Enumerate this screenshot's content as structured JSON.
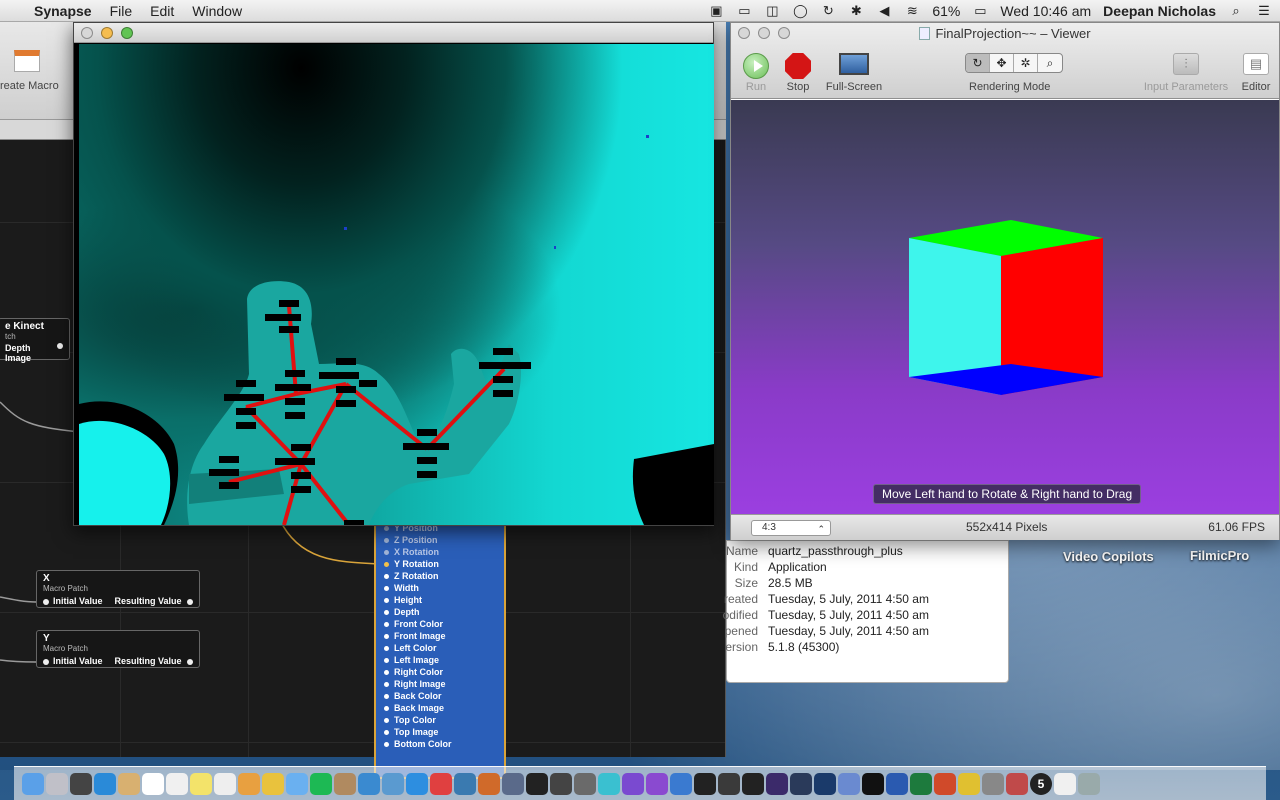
{
  "menubar": {
    "app_name": "Synapse",
    "menus": [
      "File",
      "Edit",
      "Window"
    ],
    "battery": "61%",
    "clock": "Wed 10:46 am",
    "user": "Deepan Nicholas"
  },
  "editor": {
    "toolbar_label": "reate Macro",
    "patches": {
      "kinect": {
        "title": "e Kinect",
        "subtitle": "tch",
        "output": "Depth Image"
      },
      "x": {
        "title": "X",
        "subtitle": "Macro Patch",
        "input": "Initial Value",
        "output": "Resulting Value"
      },
      "y": {
        "title": "Y",
        "subtitle": "Macro Patch",
        "input": "Initial Value",
        "output": "Resulting Value"
      }
    },
    "cube_ports": [
      {
        "label": "Y Position",
        "state": "dim"
      },
      {
        "label": "Z Position",
        "state": "dim"
      },
      {
        "label": "X Rotation",
        "state": "dim"
      },
      {
        "label": "Y Rotation",
        "state": "connected"
      },
      {
        "label": "Z Rotation",
        "state": "normal"
      },
      {
        "label": "Width",
        "state": "normal"
      },
      {
        "label": "Height",
        "state": "normal"
      },
      {
        "label": "Depth",
        "state": "normal"
      },
      {
        "label": "Front Color",
        "state": "normal"
      },
      {
        "label": "Front Image",
        "state": "normal"
      },
      {
        "label": "Left Color",
        "state": "normal"
      },
      {
        "label": "Left Image",
        "state": "normal"
      },
      {
        "label": "Right Color",
        "state": "normal"
      },
      {
        "label": "Right Image",
        "state": "normal"
      },
      {
        "label": "Back Color",
        "state": "normal"
      },
      {
        "label": "Back Image",
        "state": "normal"
      },
      {
        "label": "Top Color",
        "state": "normal"
      },
      {
        "label": "Top Image",
        "state": "normal"
      },
      {
        "label": "Bottom Color",
        "state": "normal"
      }
    ]
  },
  "viewer": {
    "title": "FinalProjection~~ – Viewer",
    "buttons": {
      "run": "Run",
      "stop": "Stop",
      "fullscreen": "Full-Screen",
      "rendering_mode": "Rendering Mode",
      "input_parameters": "Input Parameters",
      "editor": "Editor"
    },
    "hint": "Move Left hand to Rotate & Right hand to Drag",
    "aspect": "4:3",
    "dimensions": "552x414 Pixels",
    "fps": "61.06 FPS",
    "colors": {
      "cube_front": "#3ef5ec",
      "cube_right": "#ff0000",
      "cube_top": "#00ff00",
      "cube_bottom": "#0000ff"
    }
  },
  "info": {
    "rows": [
      {
        "key": "Name",
        "value": "quartz_passthrough_plus"
      },
      {
        "key": "Kind",
        "value": "Application"
      },
      {
        "key": "Size",
        "value": "28.5 MB"
      },
      {
        "key": "reated",
        "value": "Tuesday, 5 July, 2011 4:50 am"
      },
      {
        "key": "odified",
        "value": "Tuesday, 5 July, 2011 4:50 am"
      },
      {
        "key": "pened",
        "value": "Tuesday, 5 July, 2011 4:50 am"
      },
      {
        "key": "ersion",
        "value": "5.1.8 (45300)"
      }
    ]
  },
  "desktop": {
    "labels": [
      "Video Copilots",
      "FilmicPro"
    ]
  },
  "dock": {
    "icons": [
      "finder-icon",
      "launchpad-icon",
      "photo-booth-icon",
      "safari-icon",
      "preview-icon",
      "calendar-icon",
      "notes-icon",
      "stickies-icon",
      "textedit-icon",
      "pages-icon",
      "pencil-icon",
      "itunes-icon",
      "spotify-icon",
      "contacts-icon",
      "iphoto-icon",
      "mail-icon",
      "appstore-icon",
      "app-icon",
      "photo-icon",
      "garageband-icon",
      "keynote-icon",
      "final-cut-icon",
      "typora-icon",
      "app-icon",
      "app-icon",
      "imovie-icon",
      "star-icon",
      "xcode-icon",
      "unity-icon",
      "app-icon",
      "activity-monitor-icon",
      "after-effects-icon",
      "lightroom-icon",
      "photoshop-icon",
      "app-icon",
      "script-icon",
      "word-icon",
      "excel-icon",
      "powerpoint-icon",
      "chrome-icon",
      "app-icon",
      "app-icon",
      "badge-icon",
      "document-icon",
      "trash-icon"
    ],
    "badge_count": "5"
  }
}
